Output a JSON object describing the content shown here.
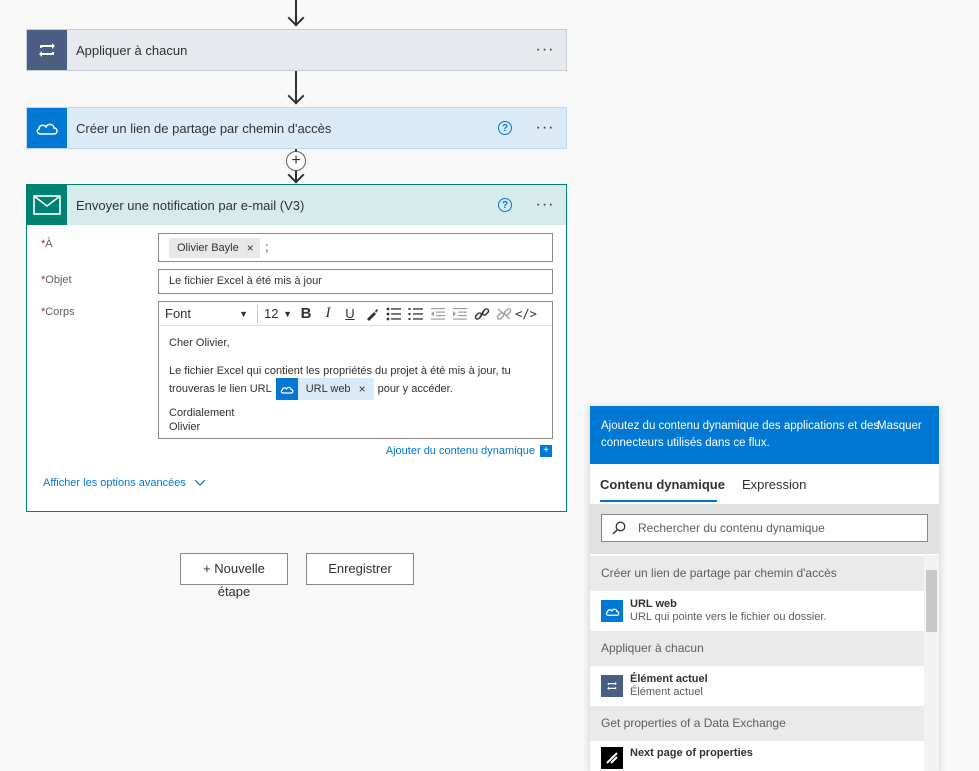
{
  "flow": {
    "apply_each": {
      "title": "Appliquer à chacun",
      "more": "···"
    },
    "create_link": {
      "title": "Créer un lien de partage par chemin d'accès",
      "help": "?",
      "more": "···"
    },
    "add_step_symbol": "+",
    "email": {
      "title": "Envoyer une notification par e-mail (V3)",
      "help": "?",
      "more": "···",
      "to_label": "À",
      "to_chip": "Olivier Bayle",
      "to_separator": ";",
      "subject_label": "Objet",
      "subject_value": "Le fichier Excel à été mis à jour",
      "body_label": "Corps",
      "required_mark": "*",
      "toolbar": {
        "font": "Font",
        "size": "12",
        "bold": "B",
        "italic": "I",
        "underline": "U"
      },
      "body": {
        "greeting": "Cher Olivier,",
        "line1": "Le fichier Excel qui contient les propriétés du projet à été mis à jour, tu",
        "line2_before": "trouveras le lien URL",
        "token": "URL web",
        "line2_after": "pour y accéder.",
        "sign1": "Cordialement",
        "sign2": "Olivier"
      },
      "add_dynamic": "Ajouter du contenu dynamique",
      "advanced": "Afficher les options avancées"
    },
    "new_step_line1": "+ Nouvelle",
    "new_step_line2": "étape",
    "save": "Enregistrer"
  },
  "panel": {
    "header_text": "Ajoutez du contenu dynamique des applications et des connecteurs utilisés dans ce flux.",
    "hide": "Masquer",
    "tab_dynamic": "Contenu dynamique",
    "tab_expression": "Expression",
    "search_placeholder": "Rechercher du contenu dynamique",
    "sections": [
      {
        "header": "Créer un lien de partage par chemin d'accès",
        "item_title": "URL web",
        "item_desc": "URL qui pointe vers le fichier ou dossier."
      },
      {
        "header": "Appliquer à chacun",
        "item_title": "Élément actuel",
        "item_desc": "Élément actuel"
      },
      {
        "header": "Get properties of a Data Exchange",
        "item_title": "Next page of properties",
        "item_desc": ""
      }
    ]
  },
  "colors": {
    "apply_each_icon": "#4a5d82",
    "apply_each_header": "#e6e9ee",
    "onedrive": "#0078d4",
    "create_link_header": "#dcebf8",
    "email_icon": "#008272",
    "email_header": "#d6ecec"
  }
}
